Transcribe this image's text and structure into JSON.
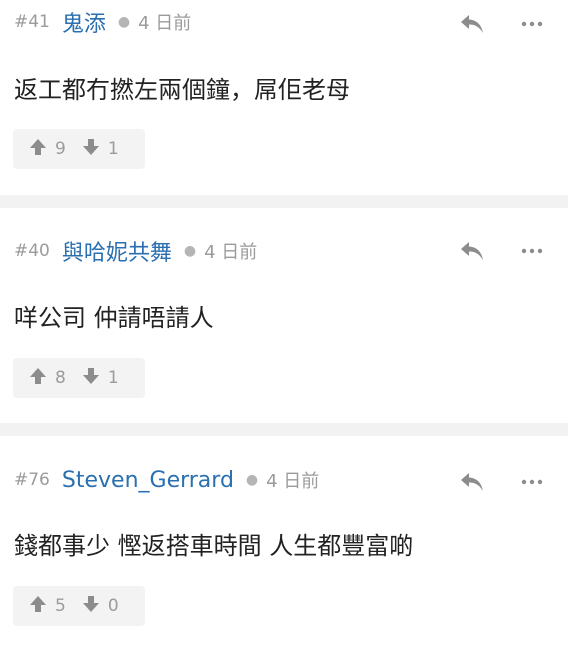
{
  "comments": [
    {
      "number": "#41",
      "username": "鬼添",
      "time": "4 日前",
      "text": "返工都冇撚左兩個鐘，屌佢老母",
      "upvotes": "9",
      "downvotes": "1"
    },
    {
      "number": "#40",
      "username": "與哈妮共舞",
      "time": "4 日前",
      "text": "咩公司 仲請唔請人",
      "upvotes": "8",
      "downvotes": "1"
    },
    {
      "number": "#76",
      "username": "Steven_Gerrard",
      "time": "4 日前",
      "text": "錢都事少 慳返搭車時間 人生都豐富啲",
      "upvotes": "5",
      "downvotes": "0"
    }
  ],
  "icons": {
    "reply": "reply-icon",
    "more": "more-icon",
    "upvote": "arrow-up-icon",
    "downvote": "arrow-down-icon"
  },
  "colors": {
    "username": "#2a6fb0",
    "muted": "#9b9b9b",
    "separator": "#f2f2f2",
    "vote_bg": "#f3f3f3"
  }
}
